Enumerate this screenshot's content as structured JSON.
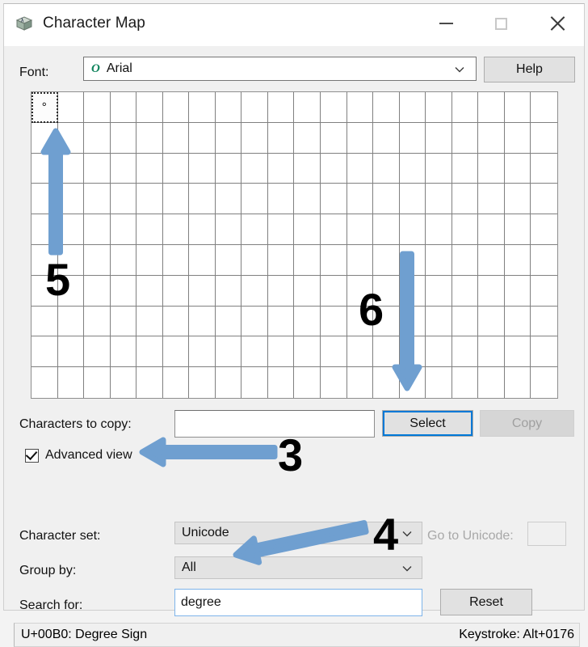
{
  "window": {
    "title": "Character Map",
    "icon": "charmap-icon",
    "controls": {
      "minimize": "minimize-icon",
      "maximize": "maximize-icon",
      "close": "close-icon"
    }
  },
  "font_row": {
    "label": "Font:",
    "value": "Arial",
    "tt_icon": "O",
    "help_label": "Help"
  },
  "grid": {
    "columns": 20,
    "rows": 10,
    "selected_char": "°",
    "selected_index": 0
  },
  "copy_row": {
    "label": "Characters to copy:",
    "value": "",
    "placeholder": "",
    "select_label": "Select",
    "copy_label": "Copy",
    "copy_disabled": true
  },
  "advanced": {
    "label": "Advanced view",
    "checked": true
  },
  "character_set": {
    "label": "Character set:",
    "value": "Unicode",
    "goto_label": "Go to Unicode:",
    "goto_value": "",
    "goto_disabled": true
  },
  "group_by": {
    "label": "Group by:",
    "value": "All"
  },
  "search": {
    "label": "Search for:",
    "value": "degree",
    "reset_label": "Reset"
  },
  "status": {
    "left": "U+00B0: Degree Sign",
    "right": "Keystroke: Alt+0176"
  },
  "annotations": {
    "arrow_color": "#6f9fd0",
    "step3": "3",
    "step4": "4",
    "step5": "5",
    "step6": "6"
  }
}
